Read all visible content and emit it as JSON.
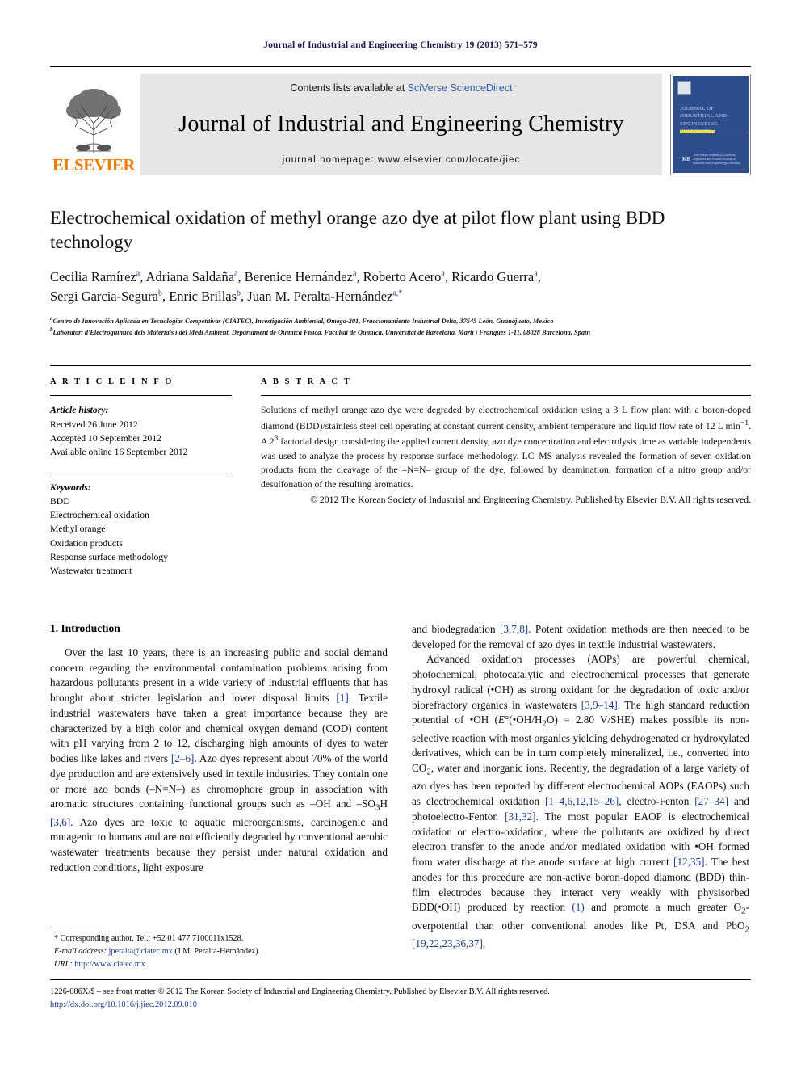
{
  "running_head": "Journal of Industrial and Engineering Chemistry 19 (2013) 571–579",
  "masthead": {
    "contents_prefix": "Contents lists available at ",
    "sciencedirect": "SciVerse ScienceDirect",
    "journal_name": "Journal of Industrial and Engineering Chemistry",
    "homepage": "journal homepage: www.elsevier.com/locate/jiec",
    "publisher_wordmark": "ELSEVIER",
    "cover": {
      "title_lines": "Journal of Industrial and Engineering Chemistry",
      "society_mark": "KB",
      "society_text": "The Korean Institute of Chemical Engineers and Korean Society of Industrial and Engineering Chemistry"
    }
  },
  "article": {
    "title": "Electrochemical oxidation of methyl orange azo dye at pilot flow plant using BDD technology",
    "authors_line_1": "Cecilia Ramírez a, Adriana Saldaña a, Berenice Hernández a, Roberto Acero a, Ricardo Guerra a,",
    "authors_line_2": "Sergi Garcia-Segura b, Enric Brillas b, Juan M. Peralta-Hernández a,*",
    "affiliation_a": "Centro de Innovación Aplicada en Tecnologías Competitivas (CIATEC), Investigación Ambiental, Omega-201, Fraccionamiento Industrial Delta, 37545 León, Guanajuato, Mexico",
    "affiliation_b": "Laboratori d'Electroquímica dels Materials i del Medi Ambient, Departament de Química Física, Facultat de Química, Universitat de Barcelona, Martí i Franquès 1-11, 08028 Barcelona, Spain"
  },
  "article_info": {
    "heading": "A R T I C L E   I N F O",
    "history_label": "Article history:",
    "history": [
      "Received 26 June 2012",
      "Accepted 10 September 2012",
      "Available online 16 September 2012"
    ],
    "keywords_label": "Keywords:",
    "keywords": [
      "BDD",
      "Electrochemical oxidation",
      "Methyl orange",
      "Oxidation products",
      "Response surface methodology",
      "Wastewater treatment"
    ]
  },
  "abstract": {
    "heading": "A B S T R A C T",
    "text": "Solutions of methyl orange azo dye were degraded by electrochemical oxidation using a 3 L flow plant with a boron-doped diamond (BDD)/stainless steel cell operating at constant current density, ambient temperature and liquid flow rate of 12 L min−1. A 23 factorial design considering the applied current density, azo dye concentration and electrolysis time as variable independents was used to analyze the process by response surface methodology. LC–MS analysis revealed the formation of seven oxidation products from the cleavage of the –N=N– group of the dye, followed by deamination, formation of a nitro group and/or desulfonation of the resulting aromatics.",
    "copyright": "© 2012 The Korean Society of Industrial and Engineering Chemistry. Published by Elsevier B.V. All rights reserved."
  },
  "introduction": {
    "section_number_title": "1. Introduction",
    "left_paragraph": "Over the last 10 years, there is an increasing public and social demand concern regarding the environmental contamination problems arising from hazardous pollutants present in a wide variety of industrial effluents that has brought about stricter legislation and lower disposal limits [1]. Textile industrial wastewaters have taken a great importance because they are characterized by a high color and chemical oxygen demand (COD) content with pH varying from 2 to 12, discharging high amounts of dyes to water bodies like lakes and rivers [2–6]. Azo dyes represent about 70% of the world dye production and are extensively used in textile industries. They contain one or more azo bonds (–N=N–) as chromophore group in association with aromatic structures containing functional groups such as –OH and –SO3H [3,6]. Azo dyes are toxic to aquatic microorganisms, carcinogenic and mutagenic to humans and are not efficiently degraded by conventional aerobic wastewater treatments because they persist under natural oxidation and reduction conditions, light exposure",
    "right_paragraph_1": "and biodegradation [3,7,8]. Potent oxidation methods are then needed to be developed for the removal of azo dyes in textile industrial wastewaters.",
    "right_paragraph_2": "Advanced oxidation processes (AOPs) are powerful chemical, photochemical, photocatalytic and electrochemical processes that generate hydroxyl radical (•OH) as strong oxidant for the degradation of toxic and/or biorefractory organics in wastewaters [3,9–14]. The high standard reduction potential of •OH (E°(•OH/H2O) = 2.80 V/SHE) makes possible its non-selective reaction with most organics yielding dehydrogenated or hydroxylated derivatives, which can be in turn completely mineralized, i.e., converted into CO2, water and inorganic ions. Recently, the degradation of a large variety of azo dyes has been reported by different electrochemical AOPs (EAOPs) such as electrochemical oxidation [1–4,6,12,15–26], electro-Fenton [27–34] and photoelectro-Fenton [31,32]. The most popular EAOP is electrochemical oxidation or electro-oxidation, where the pollutants are oxidized by direct electron transfer to the anode and/or mediated oxidation with •OH formed from water discharge at the anode surface at high current [12,35]. The best anodes for this procedure are non-active boron-doped diamond (BDD) thin-film electrodes because they interact very weakly with physisorbed BDD(•OH) produced by reaction (1) and promote a much greater O2-overpotential than other conventional anodes like Pt, DSA and PbO2 [19,22,23,36,37],"
  },
  "footnote": {
    "corresponding": "* Corresponding author. Tel.: +52 01 477 7100011x1528.",
    "email_label": "E-mail address:",
    "email": "jperalta@ciatec.mx",
    "email_owner": "(J.M. Peralta-Hernández).",
    "url_label": "URL:",
    "url": "http://www.ciatec.mx"
  },
  "page_footer": {
    "copyright_line": "1226-086X/$ – see front matter © 2012 The Korean Society of Industrial and Engineering Chemistry. Published by Elsevier B.V. All rights reserved.",
    "doi": "http://dx.doi.org/10.1016/j.jiec.2012.09.010"
  },
  "colors": {
    "elsevier_orange": "#ef7d00",
    "link_blue": "#1b3c8c",
    "cover_blue": "#2e4d8c",
    "running_head_navy": "#19194d"
  }
}
